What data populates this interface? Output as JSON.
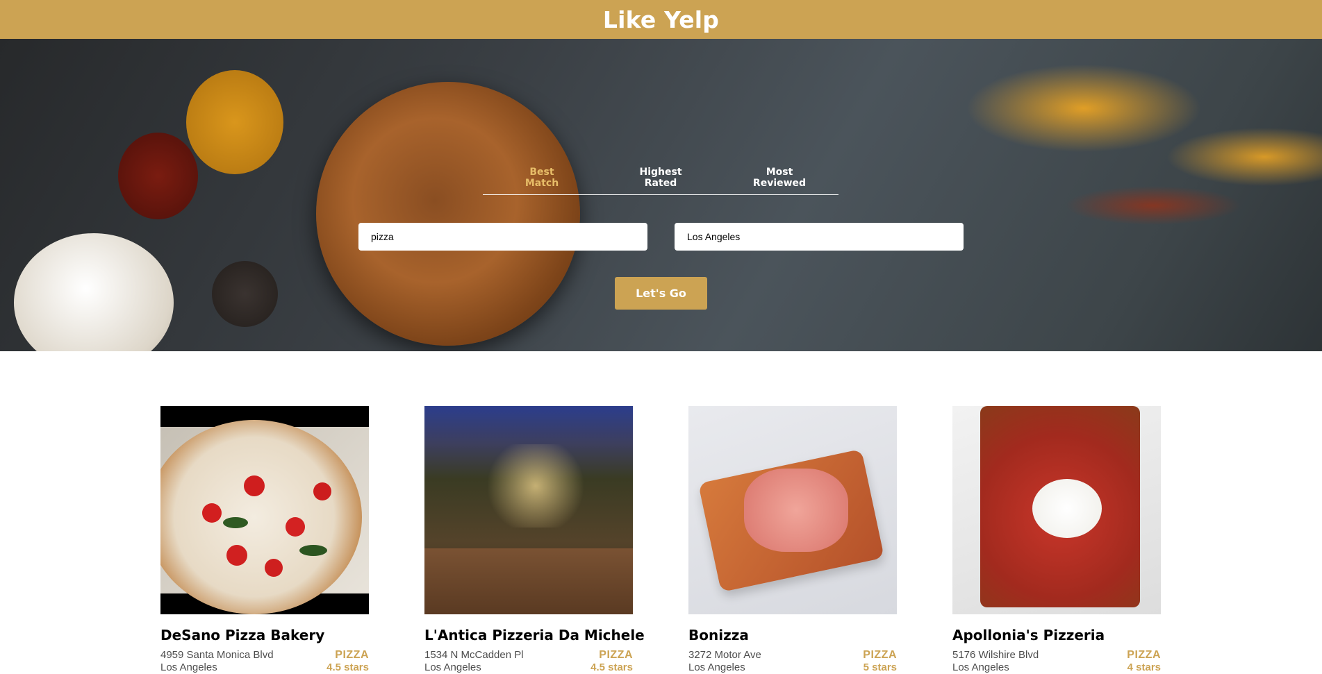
{
  "header": {
    "title": "Like Yelp"
  },
  "sort": {
    "options": [
      {
        "line1": "Best",
        "line2": "Match",
        "active": true
      },
      {
        "line1": "Highest",
        "line2": "Rated",
        "active": false
      },
      {
        "line1": "Most",
        "line2": "Reviewed",
        "active": false
      }
    ]
  },
  "search": {
    "term_value": "pizza",
    "location_value": "Los Angeles",
    "button_label": "Let's Go"
  },
  "businesses": [
    {
      "name": "DeSano Pizza Bakery",
      "address": "4959 Santa Monica Blvd",
      "city": "Los Angeles",
      "category": "PIZZA",
      "rating": "4.5 stars"
    },
    {
      "name": "L'Antica Pizzeria Da Michele",
      "address": "1534 N McCadden Pl",
      "city": "Los Angeles",
      "category": "PIZZA",
      "rating": "4.5 stars"
    },
    {
      "name": "Bonizza",
      "address": "3272 Motor Ave",
      "city": "Los Angeles",
      "category": "PIZZA",
      "rating": "5 stars"
    },
    {
      "name": "Apollonia's Pizzeria",
      "address": "5176 Wilshire Blvd",
      "city": "Los Angeles",
      "category": "PIZZA",
      "rating": "4 stars"
    }
  ],
  "colors": {
    "brand": "#cca353",
    "active_tab": "#e7bd68"
  }
}
